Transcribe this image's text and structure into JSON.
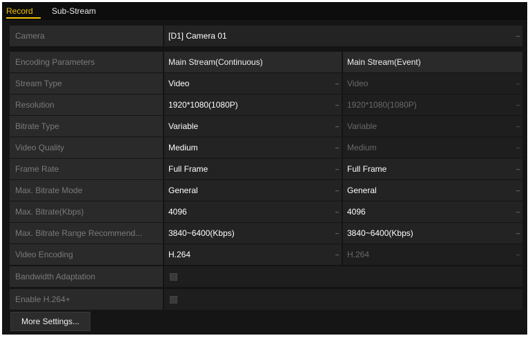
{
  "tabs": [
    {
      "label": "Record",
      "active": true
    },
    {
      "label": "Sub-Stream",
      "active": false
    }
  ],
  "camera": {
    "label": "Camera",
    "value": "[D1] Camera 01"
  },
  "encoding_header": {
    "label": "Encoding Parameters",
    "col1": "Main Stream(Continuous)",
    "col2": "Main Stream(Event)"
  },
  "rows": [
    {
      "label": "Stream Type",
      "col1": "Video",
      "col2": "Video",
      "col2_enabled": false
    },
    {
      "label": "Resolution",
      "col1": "1920*1080(1080P)",
      "col2": "1920*1080(1080P)",
      "col2_enabled": false
    },
    {
      "label": "Bitrate Type",
      "col1": "Variable",
      "col2": "Variable",
      "col2_enabled": false
    },
    {
      "label": "Video Quality",
      "col1": "Medium",
      "col2": "Medium",
      "col2_enabled": false
    },
    {
      "label": "Frame Rate",
      "col1": "Full Frame",
      "col2": "Full Frame",
      "col2_enabled": true
    },
    {
      "label": "Max. Bitrate Mode",
      "col1": "General",
      "col2": "General",
      "col2_enabled": true
    },
    {
      "label": "Max. Bitrate(Kbps)",
      "col1": "4096",
      "col2": "4096",
      "col2_enabled": true
    },
    {
      "label": "Max. Bitrate Range Recommend...",
      "col1": "3840~6400(Kbps)",
      "col2": "3840~6400(Kbps)",
      "col2_enabled": true
    },
    {
      "label": "Video Encoding",
      "col1": "H.264",
      "col2": "H.264",
      "col2_enabled": false
    }
  ],
  "bandwidth_adaptation": {
    "label": "Bandwidth Adaptation",
    "checked": false
  },
  "enable_h264plus": {
    "label": "Enable H.264+",
    "checked": false
  },
  "more_settings_label": "More Settings...",
  "colors": {
    "accent": "#f2c200",
    "background": "#151515",
    "label_bg": "#2a2a2a"
  },
  "icons": {
    "dropdown": "chevron-down-icon"
  }
}
